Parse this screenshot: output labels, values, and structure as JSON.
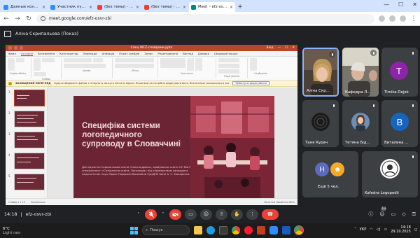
{
  "browser": {
    "tabs": [
      {
        "title": "Данные конференции - Zoom",
        "color": "#2d8cff",
        "active": false
      },
      {
        "title": "Участник публикации - Zoom",
        "color": "#2d8cff",
        "active": false
      },
      {
        "title": "(без темы) - kafedra.logo.spu",
        "color": "#ea4335",
        "active": false
      },
      {
        "title": "(без темы) - kafedra.logo.spu",
        "color": "#ea4335",
        "active": false
      },
      {
        "title": "Meet – efz-osvr-zbi",
        "color": "#00897b",
        "active": true
      }
    ],
    "url": "meet.google.com/efz-osvr-zbi",
    "new_tab": "+",
    "win_min": "—",
    "win_max": "☐",
    "win_close": "✕"
  },
  "presentation_bar": {
    "label": "Аліна Скрипальова (Показ)"
  },
  "ppt": {
    "title": "Спец WFZ-слайдами.pptx",
    "title_right": [
      "Вхід",
      "—",
      "☐",
      "✕"
    ],
    "menu": [
      "Файл",
      "Основне",
      "Вставлення",
      "Конструктор",
      "Переходи",
      "Анімація",
      "Показ слайдів",
      "Запис",
      "Рецензування",
      "Вигляд",
      "Довідка",
      "Швидкий пошук"
    ],
    "active_menu": 1,
    "ribbon_groups": [
      "Буфер обміну",
      "Слайди",
      "Шрифт",
      "Абзац",
      "Креслення",
      "Редагування",
      "Надбудови"
    ],
    "warning_title": "ЗАХИЩЕНИЙ ПЕРЕГЛЯД",
    "warning_text": "Будьте обережні: файли з Інтернету можуть містити віруси. Якщо вам не потрібно редагувати його, безпечніше залишатися в захищеному перегляді.",
    "warning_button": "Увімкнути редагування",
    "slide_numbers": [
      "1",
      "2",
      "3",
      "4",
      "5",
      "6",
      "7"
    ],
    "slide_title": "Специфіка системи логопедичного супроводу в Словаччині",
    "slide_subtitle": "Дослідження Скрипальової Аліни Олександрівни, здобувачки освіти ОС Магістр спеціальності «Спеціальна освіта. Логопедія» під керівництвом кандидата педагогічних наук Мороз Людмили Василівни СумДПУ імені А. С. Макаренка",
    "status_left": "Слайд 1 з 13",
    "status_lang": "Українська",
    "status_right": "Нотатки   Примітки   60%"
  },
  "participants": [
    {
      "name": "Аліна Скр...",
      "type": "video"
    },
    {
      "name": "Кафедра Л...",
      "type": "video"
    },
    {
      "name": "Timika Dejak",
      "type": "avatar",
      "letter": "T",
      "color": "#8e24aa"
    },
    {
      "name": "Таня Курач",
      "type": "avatar",
      "letter": "",
      "color": "#202124"
    },
    {
      "name": "Тетяна Бід...",
      "type": "photo"
    },
    {
      "name": "Виталина ...",
      "type": "avatar",
      "letter": "B",
      "color": "#1565c0"
    },
    {
      "name": "Ещё 5 чел.",
      "type": "more",
      "letter": "H",
      "color": "#5c6bc0"
    },
    {
      "name": "Kafedra Logopedii",
      "type": "logo"
    }
  ],
  "callbar": {
    "time": "14:18",
    "separator": "|",
    "meeting_code": "efz-osvr-zbi",
    "people_count": "13"
  },
  "taskbar": {
    "weather_temp": "6°C",
    "weather_desc": "Light rain",
    "search_placeholder": "Пошук",
    "lang": "УКР",
    "time": "14:18",
    "date": "29.10.2025"
  },
  "colors": {
    "slide_bg": "#6b2434",
    "ppt_accent": "#b7472a",
    "end_call": "#ea4335"
  }
}
